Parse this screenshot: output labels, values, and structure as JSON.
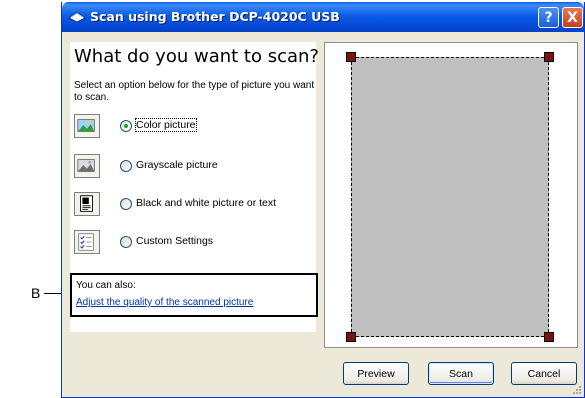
{
  "window": {
    "title": "Scan using Brother DCP-4020C USB",
    "help_label": "?",
    "close_label": "X"
  },
  "left": {
    "heading": "What do you want to scan?",
    "instructions": "Select an option below for the type of picture you want to scan.",
    "options": [
      {
        "label": "Color picture",
        "selected": true,
        "icon": "color-picture-icon"
      },
      {
        "label": "Grayscale picture",
        "selected": false,
        "icon": "grayscale-picture-icon"
      },
      {
        "label": "Black and white picture or text",
        "selected": false,
        "icon": "black-white-picture-icon"
      },
      {
        "label": "Custom Settings",
        "selected": false,
        "icon": "custom-settings-icon"
      }
    ],
    "also_label": "You can also:",
    "also_link": "Adjust the quality of the scanned picture"
  },
  "buttons": {
    "preview": "Preview",
    "scan": "Scan",
    "cancel": "Cancel"
  },
  "callout": {
    "label": "B"
  },
  "colors": {
    "titlebar": "#0b5de4",
    "dialog_bg": "#ece9d8",
    "scan_area": "#c0c0c0",
    "handles": "#7a1212",
    "link": "#0033aa"
  }
}
